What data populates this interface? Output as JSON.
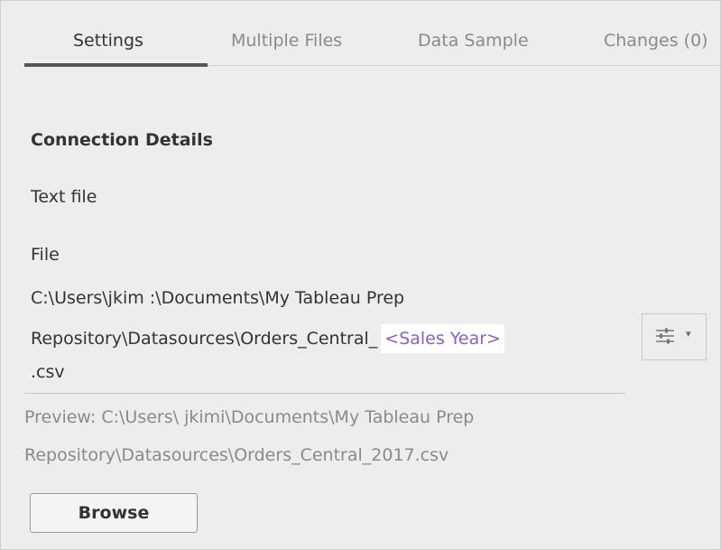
{
  "tabs": [
    {
      "label": "Settings",
      "active": true
    },
    {
      "label": "Multiple Files",
      "active": false
    },
    {
      "label": "Data Sample",
      "active": false
    },
    {
      "label": "Changes (0)",
      "active": false
    }
  ],
  "connection": {
    "title": "Connection Details",
    "type": "Text file",
    "file_label": "File",
    "path_line1": "C:\\Users\\jkim :\\Documents\\My Tableau Prep",
    "path_line2_prefix": "Repository\\Datasources\\Orders_Central_",
    "parameter": "<Sales Year>",
    "path_line3": ".csv"
  },
  "preview": {
    "line1": "Preview: C:\\Users\\ jkimi\\Documents\\My Tableau Prep",
    "line2": "Repository\\Datasources\\Orders_Central_2017.csv"
  },
  "buttons": {
    "browse_label": "Browse",
    "settings_icon": "sliders-icon",
    "settings_caret": "▾"
  },
  "colors": {
    "parameter_text": "#8a5fc7",
    "active_tab_underline": "#555555"
  }
}
